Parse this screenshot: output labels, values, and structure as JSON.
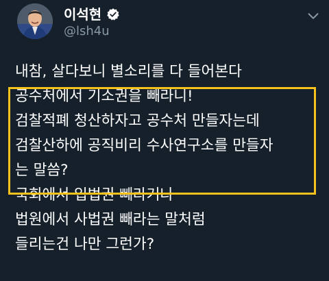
{
  "profile": {
    "display_name": "이석현",
    "handle": "@lsh4u",
    "verified": true,
    "avatar_icon": "profile-photo"
  },
  "menu": {
    "icon": "chevron-down-icon"
  },
  "tweet": {
    "lines": [
      "내참, 살다보니 별소리를 다 들어본다",
      "공수처에서 기소권을 빼라니!",
      "검찰적폐 청산하자고 공수처 만들자는데",
      "검찰산하에 공직비리 수사연구소를 만들자",
      "는 말씀?",
      "국회에서 입법권 빼라거나",
      "법원에서 사법권 빼라는 말처럼",
      "들리는건 나만 그런가?"
    ]
  },
  "colors": {
    "background": "#15202b",
    "text": "#ffffff",
    "handle": "#8899a6",
    "verified_badge": "#ffffff",
    "highlight": "#f7c21a"
  }
}
